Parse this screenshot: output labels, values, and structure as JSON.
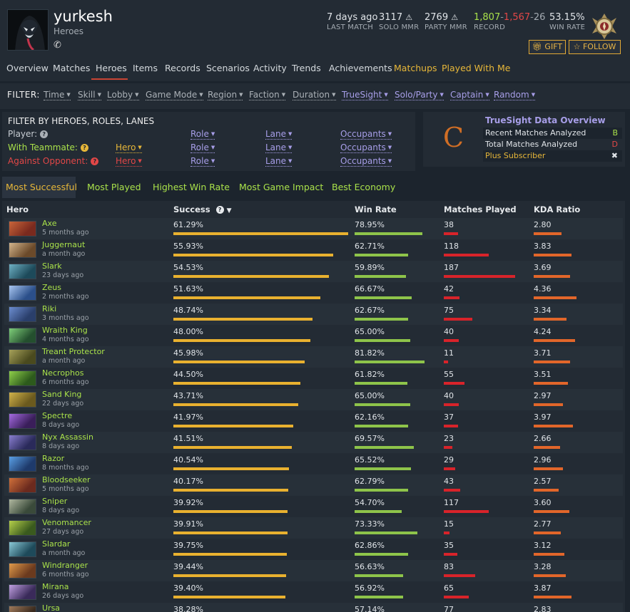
{
  "profile": {
    "name": "yurkesh",
    "subtitle": "Heroes",
    "stats": [
      {
        "value": "7 days ago",
        "label": "LAST MATCH"
      },
      {
        "value": "3117",
        "label": "SOLO MMR"
      },
      {
        "value": "2769",
        "label": "PARTY MMR"
      },
      {
        "label": "RECORD",
        "wins": "1,807",
        "losses": "1,567",
        "abandons": "26"
      },
      {
        "value": "53.15%",
        "label": "WIN RATE"
      }
    ],
    "gift_label": "GIFT",
    "follow_label": "FOLLOW"
  },
  "colors": {
    "win": "#a9e14a",
    "loss": "#e24747",
    "accent": "#e7b739",
    "truesight": "#a79ee8"
  },
  "nav": [
    {
      "label": "Overview"
    },
    {
      "label": "Matches"
    },
    {
      "label": "Heroes",
      "active": true
    },
    {
      "label": "Items"
    },
    {
      "label": "Records"
    },
    {
      "label": "Scenarios"
    },
    {
      "label": "Activity"
    },
    {
      "label": "Trends"
    },
    {
      "label": "Achievements"
    },
    {
      "label": "Matchups"
    },
    {
      "label": "Played With Me"
    }
  ],
  "filter": {
    "label": "FILTER:",
    "items": [
      "Time",
      "Skill",
      "Lobby",
      "Game Mode",
      "Region",
      "Faction",
      "Duration",
      "TrueSight",
      "Solo/Party",
      "Captain",
      "Random"
    ]
  },
  "hero_filter": {
    "title": "FILTER BY HEROES, ROLES, LANES",
    "player_label": "Player:",
    "teammate_label": "With Teammate:",
    "opponent_label": "Against Opponent:",
    "hero": "Hero",
    "role": "Role",
    "lane": "Lane",
    "occupants": "Occupants"
  },
  "truesight": {
    "grade": "C",
    "title": "TrueSight Data Overview",
    "rows": [
      {
        "label": "Recent Matches Analyzed",
        "grade": "B"
      },
      {
        "label": "Total Matches Analyzed",
        "grade": "D"
      },
      {
        "label": "Plus Subscriber",
        "grade": "✖"
      }
    ]
  },
  "tabs": [
    "Most Successful",
    "Most Played",
    "Highest Win Rate",
    "Most Game Impact",
    "Best Economy"
  ],
  "table": {
    "columns": [
      "Hero",
      "Success",
      "Win Rate",
      "Matches Played",
      "KDA Ratio"
    ],
    "rows": [
      {
        "hero": "Axe",
        "time": "5 months ago",
        "success": "61.29%",
        "winrate": "78.95%",
        "matches": "38",
        "kda": "2.80"
      },
      {
        "hero": "Juggernaut",
        "time": "a month ago",
        "success": "55.93%",
        "winrate": "62.71%",
        "matches": "118",
        "kda": "3.83"
      },
      {
        "hero": "Slark",
        "time": "23 days ago",
        "success": "54.53%",
        "winrate": "59.89%",
        "matches": "187",
        "kda": "3.69"
      },
      {
        "hero": "Zeus",
        "time": "2 months ago",
        "success": "51.63%",
        "winrate": "66.67%",
        "matches": "42",
        "kda": "4.36"
      },
      {
        "hero": "Riki",
        "time": "3 months ago",
        "success": "48.74%",
        "winrate": "62.67%",
        "matches": "75",
        "kda": "3.34"
      },
      {
        "hero": "Wraith King",
        "time": "4 months ago",
        "success": "48.00%",
        "winrate": "65.00%",
        "matches": "40",
        "kda": "4.24"
      },
      {
        "hero": "Treant Protector",
        "time": "a month ago",
        "success": "45.98%",
        "winrate": "81.82%",
        "matches": "11",
        "kda": "3.71"
      },
      {
        "hero": "Necrophos",
        "time": "6 months ago",
        "success": "44.50%",
        "winrate": "61.82%",
        "matches": "55",
        "kda": "3.51"
      },
      {
        "hero": "Sand King",
        "time": "22 days ago",
        "success": "43.71%",
        "winrate": "65.00%",
        "matches": "40",
        "kda": "2.97"
      },
      {
        "hero": "Spectre",
        "time": "8 days ago",
        "success": "41.97%",
        "winrate": "62.16%",
        "matches": "37",
        "kda": "3.97"
      },
      {
        "hero": "Nyx Assassin",
        "time": "8 days ago",
        "success": "41.51%",
        "winrate": "69.57%",
        "matches": "23",
        "kda": "2.66"
      },
      {
        "hero": "Razor",
        "time": "8 months ago",
        "success": "40.54%",
        "winrate": "65.52%",
        "matches": "29",
        "kda": "2.96"
      },
      {
        "hero": "Bloodseeker",
        "time": "5 months ago",
        "success": "40.17%",
        "winrate": "62.79%",
        "matches": "43",
        "kda": "2.57"
      },
      {
        "hero": "Sniper",
        "time": "8 days ago",
        "success": "39.92%",
        "winrate": "54.70%",
        "matches": "117",
        "kda": "3.60"
      },
      {
        "hero": "Venomancer",
        "time": "27 days ago",
        "success": "39.91%",
        "winrate": "73.33%",
        "matches": "15",
        "kda": "2.77"
      },
      {
        "hero": "Slardar",
        "time": "a month ago",
        "success": "39.75%",
        "winrate": "62.86%",
        "matches": "35",
        "kda": "3.12"
      },
      {
        "hero": "Windranger",
        "time": "6 months ago",
        "success": "39.44%",
        "winrate": "56.63%",
        "matches": "83",
        "kda": "3.28"
      },
      {
        "hero": "Mirana",
        "time": "26 days ago",
        "success": "39.40%",
        "winrate": "56.92%",
        "matches": "65",
        "kda": "3.87"
      },
      {
        "hero": "Ursa",
        "time": "",
        "success": "38.28%",
        "winrate": "57.14%",
        "matches": "77",
        "kda": "2.83"
      }
    ]
  }
}
